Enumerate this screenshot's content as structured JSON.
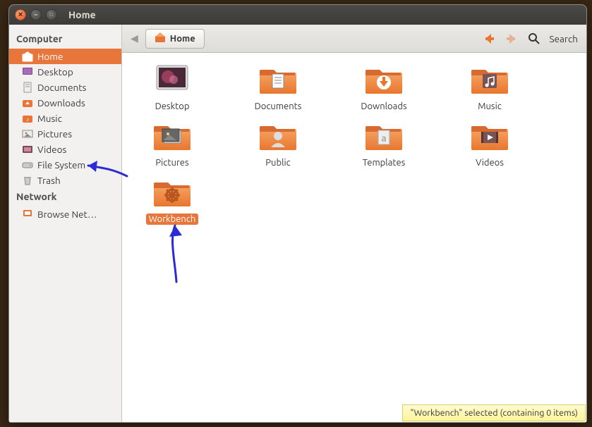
{
  "window": {
    "title": "Home"
  },
  "sidebar": {
    "computer_head": "Computer",
    "network_head": "Network",
    "items": [
      {
        "label": "Home",
        "icon": "home"
      },
      {
        "label": "Desktop",
        "icon": "desktop"
      },
      {
        "label": "Documents",
        "icon": "documents"
      },
      {
        "label": "Downloads",
        "icon": "downloads"
      },
      {
        "label": "Music",
        "icon": "music"
      },
      {
        "label": "Pictures",
        "icon": "pictures"
      },
      {
        "label": "Videos",
        "icon": "videos"
      },
      {
        "label": "File System",
        "icon": "disk"
      },
      {
        "label": "Trash",
        "icon": "trash"
      }
    ],
    "network_items": [
      {
        "label": "Browse Net…",
        "icon": "network"
      }
    ]
  },
  "toolbar": {
    "path_label": "Home",
    "search_label": "Search"
  },
  "folders": [
    {
      "name": "Desktop",
      "type": "desktop"
    },
    {
      "name": "Documents",
      "type": "documents"
    },
    {
      "name": "Downloads",
      "type": "downloads"
    },
    {
      "name": "Music",
      "type": "music"
    },
    {
      "name": "Pictures",
      "type": "pictures"
    },
    {
      "name": "Public",
      "type": "public"
    },
    {
      "name": "Templates",
      "type": "templates"
    },
    {
      "name": "Videos",
      "type": "videos"
    },
    {
      "name": "Workbench",
      "type": "settings",
      "selected": true
    }
  ],
  "status": {
    "text": "\"Workbench\" selected (containing 0 items)"
  },
  "colors": {
    "accent": "#e8753a",
    "folder1": "#f39b5e",
    "folder2": "#e87536"
  }
}
